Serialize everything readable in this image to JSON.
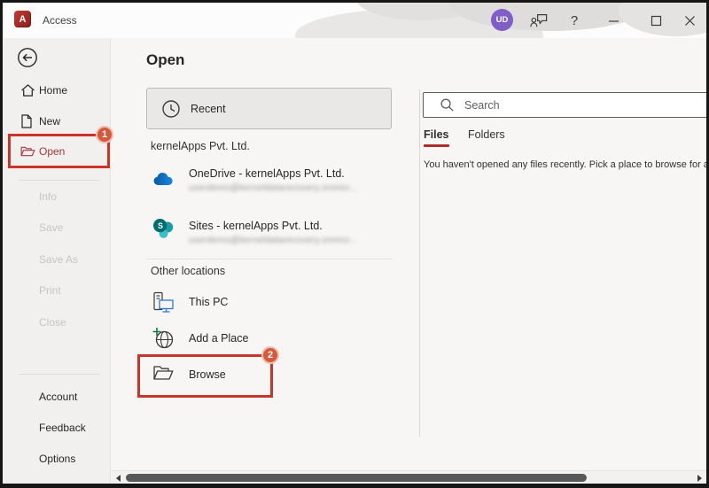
{
  "titlebar": {
    "app_title": "Access",
    "app_icon_letter": "A",
    "avatar_initials": "UD",
    "help_glyph": "?"
  },
  "sidebar": {
    "items": [
      {
        "label": "Home"
      },
      {
        "label": "New"
      },
      {
        "label": "Open"
      }
    ],
    "disabled_items": [
      {
        "label": "Info"
      },
      {
        "label": "Save"
      },
      {
        "label": "Save As"
      },
      {
        "label": "Print"
      },
      {
        "label": "Close"
      }
    ],
    "bottom_items": [
      {
        "label": "Account"
      },
      {
        "label": "Feedback"
      },
      {
        "label": "Options"
      }
    ]
  },
  "main": {
    "heading": "Open",
    "recent": {
      "label": "Recent"
    },
    "org": {
      "title": "kernelApps Pvt. Ltd.",
      "items": [
        {
          "label": "OneDrive - kernelApps Pvt. Ltd.",
          "email": "userdemo@kerneldatarecovery.onmicr...",
          "icon_letter": ""
        },
        {
          "label": "Sites - kernelApps Pvt. Ltd.",
          "email": "userdemo@kerneldatarecovery.onmicr...",
          "icon_letter": "S"
        }
      ]
    },
    "other": {
      "title": "Other locations",
      "items": [
        {
          "label": "This PC"
        },
        {
          "label": "Add a Place"
        },
        {
          "label": "Browse"
        }
      ]
    }
  },
  "right_panel": {
    "search_placeholder": "Search",
    "tabs": [
      {
        "label": "Files",
        "active": true
      },
      {
        "label": "Folders",
        "active": false
      }
    ],
    "empty_message": "You haven't opened any files recently. Pick a place to browse for a file."
  },
  "annotations": {
    "step1": "1",
    "step2": "2"
  },
  "colors": {
    "accent_red": "#a4373a",
    "annotation_red": "#c9342b",
    "badge_fill": "#d6593c",
    "files_underline": "#b02a28",
    "avatar_purple": "#7f5fc7",
    "onedrive_blue": "#0b63b8",
    "sharepoint_teal": "#036c70"
  }
}
